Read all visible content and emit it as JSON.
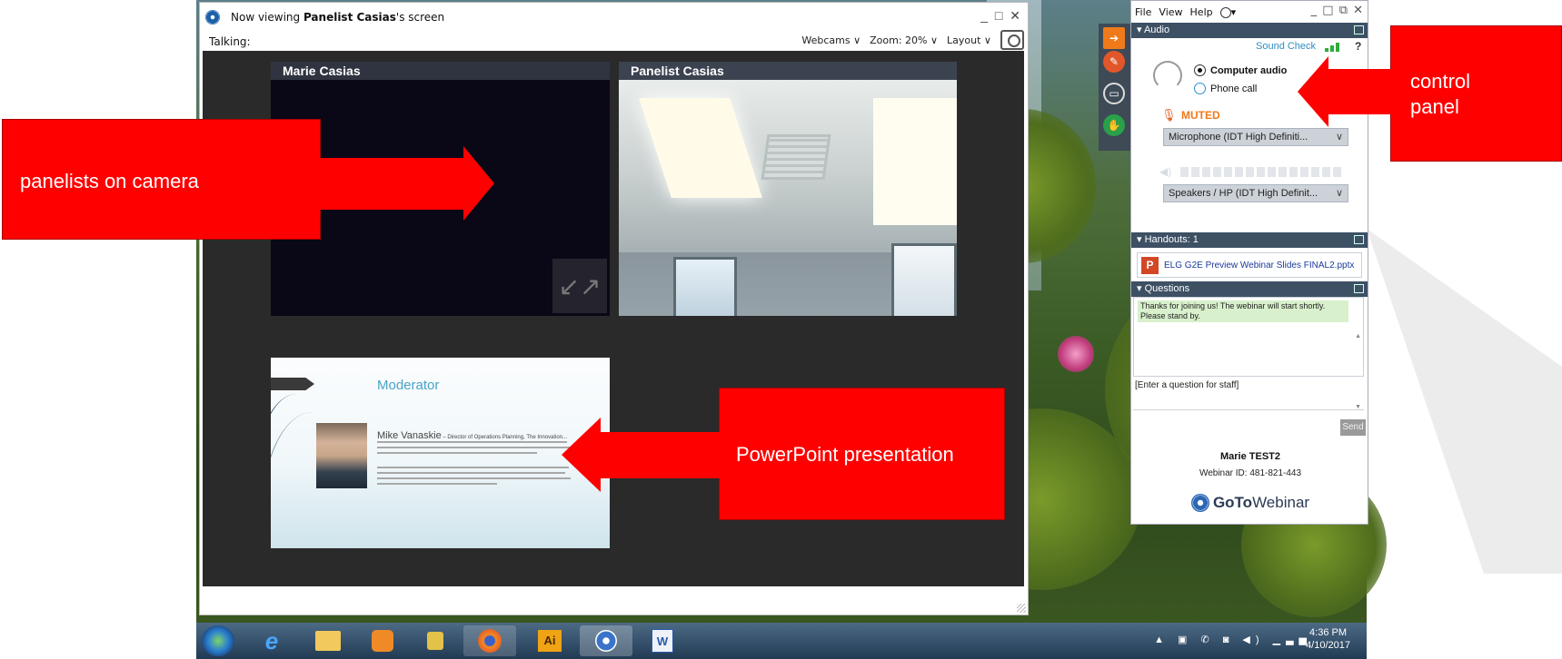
{
  "viewer": {
    "title_prefix": "Now viewing ",
    "title_name": "Panelist Casias",
    "title_suffix": "'s screen",
    "window_controls": "_ □ ✕",
    "talking_label": "Talking:",
    "webcams_label": "Webcams ∨",
    "zoom_label": "Zoom: 20% ∨",
    "layout_label": "Layout ∨",
    "tiles": [
      {
        "label": "Marie Casias"
      },
      {
        "label": "Panelist Casias"
      }
    ],
    "expand_icon": "↙↗",
    "slide": {
      "title": "Moderator",
      "speaker_name": "Mike Vanaskie",
      "speaker_suffix": " – Director of Operations Planning, The Innovation..."
    }
  },
  "panel": {
    "menu": [
      "File",
      "View",
      "Help"
    ],
    "globe_caret": "▾",
    "window_controls": "_ □ ⧉ ✕",
    "audio": {
      "header": "▾ Audio",
      "sound_check": "Sound Check",
      "help": "?",
      "option_computer": "Computer audio",
      "option_phone": "Phone call",
      "selected": "Computer audio",
      "muted_label": "MUTED",
      "microphone": "Microphone (IDT High Definiti...",
      "speakers": "Speakers / HP (IDT High Definit...",
      "chevron": "∨"
    },
    "handouts": {
      "header": "▾ Handouts: 1",
      "file": "ELG G2E Preview Webinar Slides FINAL2.pptx",
      "file_icon": "P"
    },
    "questions": {
      "header": "▾ Questions",
      "message": "Thanks for joining us!  The webinar will start shortly.  Please stand by.",
      "prompt": "[Enter a question for staff]",
      "send_label": "Send"
    },
    "user_name": "Marie TEST2",
    "webinar_id": "Webinar ID: 481-821-443",
    "brand_bold": "GoTo",
    "brand_light": "Webinar"
  },
  "annotations": {
    "camera": "panelists on camera",
    "powerpoint": "PowerPoint presentation",
    "control": "control\npanel"
  },
  "taskbar": {
    "items": [
      "start",
      "internet-explorer",
      "file-explorer",
      "media-player",
      "lock-app",
      "firefox",
      "illustrator",
      "gotowebinar",
      "word"
    ],
    "illustrator_label": "Ai",
    "word_label": "W",
    "time": "4:36 PM",
    "date": "4/10/2017"
  },
  "colors": {
    "annotation_red": "#ff0000",
    "panel_header": "#3d5064",
    "muted": "#f07a1a",
    "sound_check": "#2d8fc0"
  }
}
